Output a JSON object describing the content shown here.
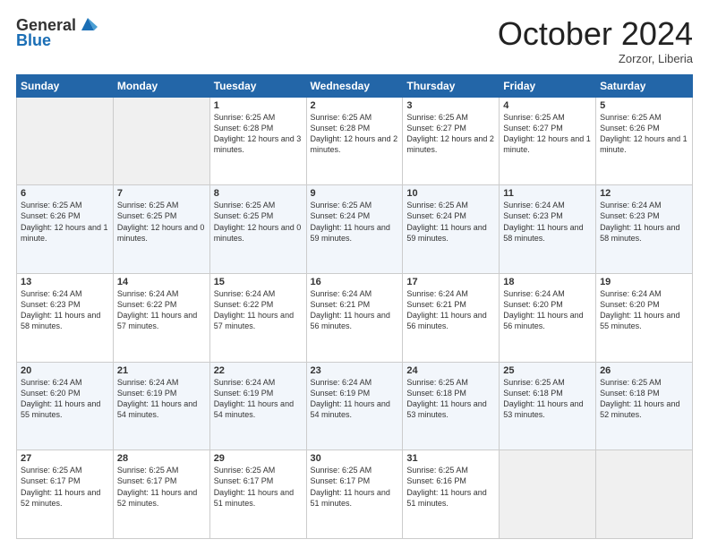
{
  "header": {
    "logo_line1": "General",
    "logo_line2": "Blue",
    "month": "October 2024",
    "location": "Zorzor, Liberia"
  },
  "weekdays": [
    "Sunday",
    "Monday",
    "Tuesday",
    "Wednesday",
    "Thursday",
    "Friday",
    "Saturday"
  ],
  "weeks": [
    [
      {
        "day": "",
        "empty": true
      },
      {
        "day": "",
        "empty": true
      },
      {
        "day": "1",
        "sunrise": "Sunrise: 6:25 AM",
        "sunset": "Sunset: 6:28 PM",
        "daylight": "Daylight: 12 hours and 3 minutes."
      },
      {
        "day": "2",
        "sunrise": "Sunrise: 6:25 AM",
        "sunset": "Sunset: 6:28 PM",
        "daylight": "Daylight: 12 hours and 2 minutes."
      },
      {
        "day": "3",
        "sunrise": "Sunrise: 6:25 AM",
        "sunset": "Sunset: 6:27 PM",
        "daylight": "Daylight: 12 hours and 2 minutes."
      },
      {
        "day": "4",
        "sunrise": "Sunrise: 6:25 AM",
        "sunset": "Sunset: 6:27 PM",
        "daylight": "Daylight: 12 hours and 1 minute."
      },
      {
        "day": "5",
        "sunrise": "Sunrise: 6:25 AM",
        "sunset": "Sunset: 6:26 PM",
        "daylight": "Daylight: 12 hours and 1 minute."
      }
    ],
    [
      {
        "day": "6",
        "sunrise": "Sunrise: 6:25 AM",
        "sunset": "Sunset: 6:26 PM",
        "daylight": "Daylight: 12 hours and 1 minute."
      },
      {
        "day": "7",
        "sunrise": "Sunrise: 6:25 AM",
        "sunset": "Sunset: 6:25 PM",
        "daylight": "Daylight: 12 hours and 0 minutes."
      },
      {
        "day": "8",
        "sunrise": "Sunrise: 6:25 AM",
        "sunset": "Sunset: 6:25 PM",
        "daylight": "Daylight: 12 hours and 0 minutes."
      },
      {
        "day": "9",
        "sunrise": "Sunrise: 6:25 AM",
        "sunset": "Sunset: 6:24 PM",
        "daylight": "Daylight: 11 hours and 59 minutes."
      },
      {
        "day": "10",
        "sunrise": "Sunrise: 6:25 AM",
        "sunset": "Sunset: 6:24 PM",
        "daylight": "Daylight: 11 hours and 59 minutes."
      },
      {
        "day": "11",
        "sunrise": "Sunrise: 6:24 AM",
        "sunset": "Sunset: 6:23 PM",
        "daylight": "Daylight: 11 hours and 58 minutes."
      },
      {
        "day": "12",
        "sunrise": "Sunrise: 6:24 AM",
        "sunset": "Sunset: 6:23 PM",
        "daylight": "Daylight: 11 hours and 58 minutes."
      }
    ],
    [
      {
        "day": "13",
        "sunrise": "Sunrise: 6:24 AM",
        "sunset": "Sunset: 6:23 PM",
        "daylight": "Daylight: 11 hours and 58 minutes."
      },
      {
        "day": "14",
        "sunrise": "Sunrise: 6:24 AM",
        "sunset": "Sunset: 6:22 PM",
        "daylight": "Daylight: 11 hours and 57 minutes."
      },
      {
        "day": "15",
        "sunrise": "Sunrise: 6:24 AM",
        "sunset": "Sunset: 6:22 PM",
        "daylight": "Daylight: 11 hours and 57 minutes."
      },
      {
        "day": "16",
        "sunrise": "Sunrise: 6:24 AM",
        "sunset": "Sunset: 6:21 PM",
        "daylight": "Daylight: 11 hours and 56 minutes."
      },
      {
        "day": "17",
        "sunrise": "Sunrise: 6:24 AM",
        "sunset": "Sunset: 6:21 PM",
        "daylight": "Daylight: 11 hours and 56 minutes."
      },
      {
        "day": "18",
        "sunrise": "Sunrise: 6:24 AM",
        "sunset": "Sunset: 6:20 PM",
        "daylight": "Daylight: 11 hours and 56 minutes."
      },
      {
        "day": "19",
        "sunrise": "Sunrise: 6:24 AM",
        "sunset": "Sunset: 6:20 PM",
        "daylight": "Daylight: 11 hours and 55 minutes."
      }
    ],
    [
      {
        "day": "20",
        "sunrise": "Sunrise: 6:24 AM",
        "sunset": "Sunset: 6:20 PM",
        "daylight": "Daylight: 11 hours and 55 minutes."
      },
      {
        "day": "21",
        "sunrise": "Sunrise: 6:24 AM",
        "sunset": "Sunset: 6:19 PM",
        "daylight": "Daylight: 11 hours and 54 minutes."
      },
      {
        "day": "22",
        "sunrise": "Sunrise: 6:24 AM",
        "sunset": "Sunset: 6:19 PM",
        "daylight": "Daylight: 11 hours and 54 minutes."
      },
      {
        "day": "23",
        "sunrise": "Sunrise: 6:24 AM",
        "sunset": "Sunset: 6:19 PM",
        "daylight": "Daylight: 11 hours and 54 minutes."
      },
      {
        "day": "24",
        "sunrise": "Sunrise: 6:25 AM",
        "sunset": "Sunset: 6:18 PM",
        "daylight": "Daylight: 11 hours and 53 minutes."
      },
      {
        "day": "25",
        "sunrise": "Sunrise: 6:25 AM",
        "sunset": "Sunset: 6:18 PM",
        "daylight": "Daylight: 11 hours and 53 minutes."
      },
      {
        "day": "26",
        "sunrise": "Sunrise: 6:25 AM",
        "sunset": "Sunset: 6:18 PM",
        "daylight": "Daylight: 11 hours and 52 minutes."
      }
    ],
    [
      {
        "day": "27",
        "sunrise": "Sunrise: 6:25 AM",
        "sunset": "Sunset: 6:17 PM",
        "daylight": "Daylight: 11 hours and 52 minutes."
      },
      {
        "day": "28",
        "sunrise": "Sunrise: 6:25 AM",
        "sunset": "Sunset: 6:17 PM",
        "daylight": "Daylight: 11 hours and 52 minutes."
      },
      {
        "day": "29",
        "sunrise": "Sunrise: 6:25 AM",
        "sunset": "Sunset: 6:17 PM",
        "daylight": "Daylight: 11 hours and 51 minutes."
      },
      {
        "day": "30",
        "sunrise": "Sunrise: 6:25 AM",
        "sunset": "Sunset: 6:17 PM",
        "daylight": "Daylight: 11 hours and 51 minutes."
      },
      {
        "day": "31",
        "sunrise": "Sunrise: 6:25 AM",
        "sunset": "Sunset: 6:16 PM",
        "daylight": "Daylight: 11 hours and 51 minutes."
      },
      {
        "day": "",
        "empty": true
      },
      {
        "day": "",
        "empty": true
      }
    ]
  ]
}
